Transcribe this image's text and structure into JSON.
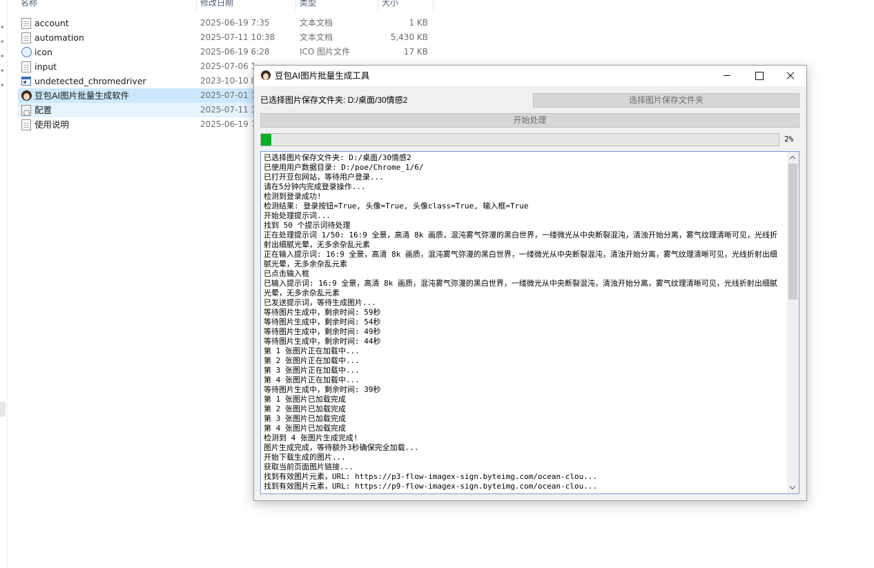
{
  "explorer": {
    "columns": [
      "名称",
      "修改日期",
      "类型",
      "大小"
    ],
    "files": [
      {
        "name": "account",
        "date": "2025-06-19 7:35",
        "type": "文本文档",
        "size": "1 KB",
        "icon": "text-document-icon"
      },
      {
        "name": "automation",
        "date": "2025-07-11 10:38",
        "type": "文本文档",
        "size": "5,430 KB",
        "icon": "text-document-icon"
      },
      {
        "name": "icon",
        "date": "2025-06-19 6:28",
        "type": "ICO 图片文件",
        "size": "17 KB",
        "icon": "ico-file-icon"
      },
      {
        "name": "input",
        "date": "2025-07-06 1",
        "type": "",
        "size": "",
        "icon": "text-document-icon"
      },
      {
        "name": "undetected_chromedriver",
        "date": "2023-10-10 8",
        "type": "",
        "size": "",
        "icon": "application-icon"
      },
      {
        "name": "豆包AI图片批量生成软件",
        "date": "2025-07-01 1",
        "type": "",
        "size": "",
        "icon": "app-avatar-icon"
      },
      {
        "name": "配置",
        "date": "2025-07-11 1",
        "type": "",
        "size": "",
        "icon": "settings-file-icon"
      },
      {
        "name": "使用说明",
        "date": "2025-06-19 7",
        "type": "",
        "size": "",
        "icon": "text-document-icon"
      }
    ]
  },
  "window": {
    "title": "豆包AI图片批量生成工具",
    "folder_label": "已选择图片保存文件夹: D:/桌面/30情感2",
    "choose_folder_button": "选择图片保存文件夹",
    "start_button": "开始处理",
    "progress_percent": 2,
    "progress_text": "2%",
    "log": [
      "已选择图片保存文件夹: D:/桌面/30情感2",
      "已使用用户数据目录: D:/poe/Chrome_1/6/",
      "已打开豆包网站，等待用户登录...",
      "请在5分钟内完成登录操作...",
      "检测到登录成功!",
      "检测结果: 登录按钮=True, 头像=True, 头像class=True, 输入框=True",
      "开始处理提示词...",
      "找到 50 个提示词待处理",
      "正在处理提示词 1/50: 16:9 全景，高清 8k 画质，混沌雾气弥漫的黑白世界，一缕微光从中央断裂混沌，清浊开始分离，雾气纹理清晰可见，光线折射出细腻光晕，无多余杂乱元素",
      "正在输入提示词: 16:9 全景，高清 8k 画质，混沌雾气弥漫的黑白世界，一缕微光从中央断裂混沌，清浊开始分离，雾气纹理清晰可见，光线折射出细腻光晕，无多余杂乱元素",
      "已点击输入框",
      "已输入提示词: 16:9 全景，高清 8k 画质，混沌雾气弥漫的黑白世界，一缕微光从中央断裂混沌，清浊开始分离，雾气纹理清晰可见，光线折射出细腻光晕，无多余杂乱元素",
      "已发送提示词，等待生成图片...",
      "等待图片生成中，剩余时间: 59秒",
      "等待图片生成中，剩余时间: 54秒",
      "等待图片生成中，剩余时间: 49秒",
      "等待图片生成中，剩余时间: 44秒",
      "第 1 张图片正在加载中...",
      "第 2 张图片正在加载中...",
      "第 3 张图片正在加载中...",
      "第 4 张图片正在加载中...",
      "等待图片生成中，剩余时间: 39秒",
      "第 1 张图片已加载完成",
      "第 2 张图片已加载完成",
      "第 3 张图片已加载完成",
      "第 4 张图片已加载完成",
      "检测到 4 张图片生成完成!",
      "图片生成完成，等待额外3秒确保完全加载...",
      "开始下载生成的图片...",
      "获取当前页面图片链接...",
      "找到有效图片元素，URL: https://p3-flow-imagex-sign.byteimg.com/ocean-clou...",
      "找到有效图片元素，URL: https://p9-flow-imagex-sign.byteimg.com/ocean-clou..."
    ]
  }
}
